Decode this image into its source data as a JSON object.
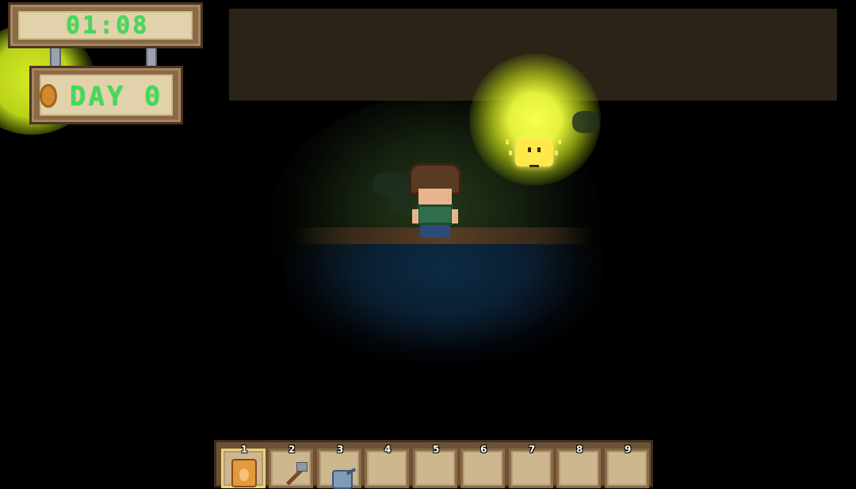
{
  "hud": {
    "clock": "01:08",
    "day": "DAY 0"
  },
  "hotbar": {
    "selected_slot": 1,
    "slots": [
      {
        "number": "1",
        "item": "seed-bag-icon"
      },
      {
        "number": "2",
        "item": "hoe-icon"
      },
      {
        "number": "3",
        "item": "watering-can-icon"
      },
      {
        "number": "4",
        "item": ""
      },
      {
        "number": "5",
        "item": ""
      },
      {
        "number": "6",
        "item": ""
      },
      {
        "number": "7",
        "item": ""
      },
      {
        "number": "8",
        "item": ""
      },
      {
        "number": "9",
        "item": ""
      }
    ]
  },
  "colors": {
    "lcd_text": "#43d95a",
    "wood": "#8a6b46",
    "sprite_glow": "#f8ff50",
    "top_panel": "#2b2416"
  }
}
